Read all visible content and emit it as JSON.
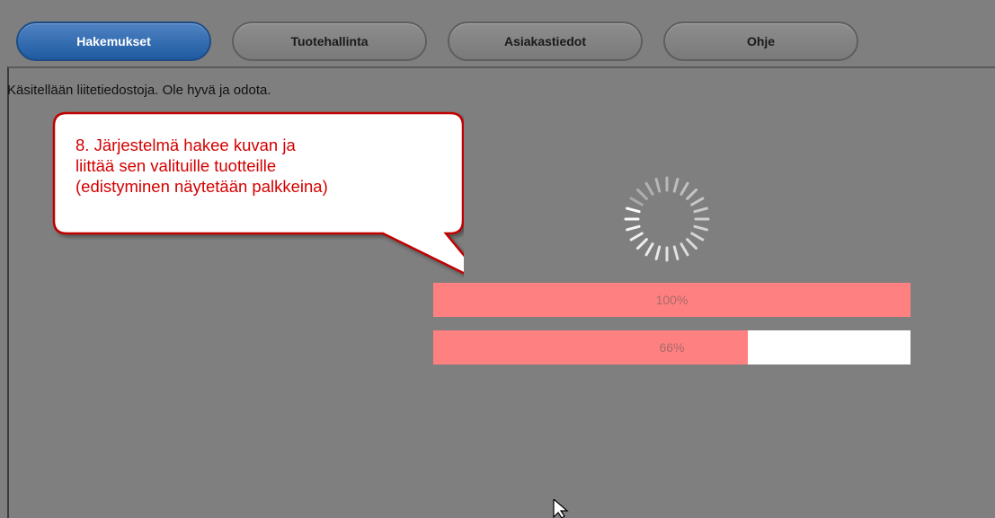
{
  "nav": {
    "tabs": [
      {
        "label": "Hakemukset",
        "active": true
      },
      {
        "label": "Tuotehallinta",
        "active": false
      },
      {
        "label": "Asiakastiedot",
        "active": false
      },
      {
        "label": "Ohje",
        "active": false
      }
    ]
  },
  "status_text": "Käsitellään liitetiedostoja. Ole hyvä ja odota.",
  "callout": {
    "lines": [
      "8. Järjestelmä hakee kuvan ja",
      "liittää sen valituille tuotteille",
      "(edistyminen näytetään palkkeina)"
    ]
  },
  "progress": [
    {
      "label": "100%",
      "fraction": 1.0
    },
    {
      "label": "66%",
      "fraction": 0.66
    }
  ],
  "colors": {
    "bar_fill": "#ff8080",
    "bar_track": "#ffffff",
    "callout_text": "#d40000",
    "active_tab": "#1f5aa1"
  },
  "icons": {
    "spinner": "loading-spinner-icon",
    "cursor": "mouse-pointer-icon"
  }
}
